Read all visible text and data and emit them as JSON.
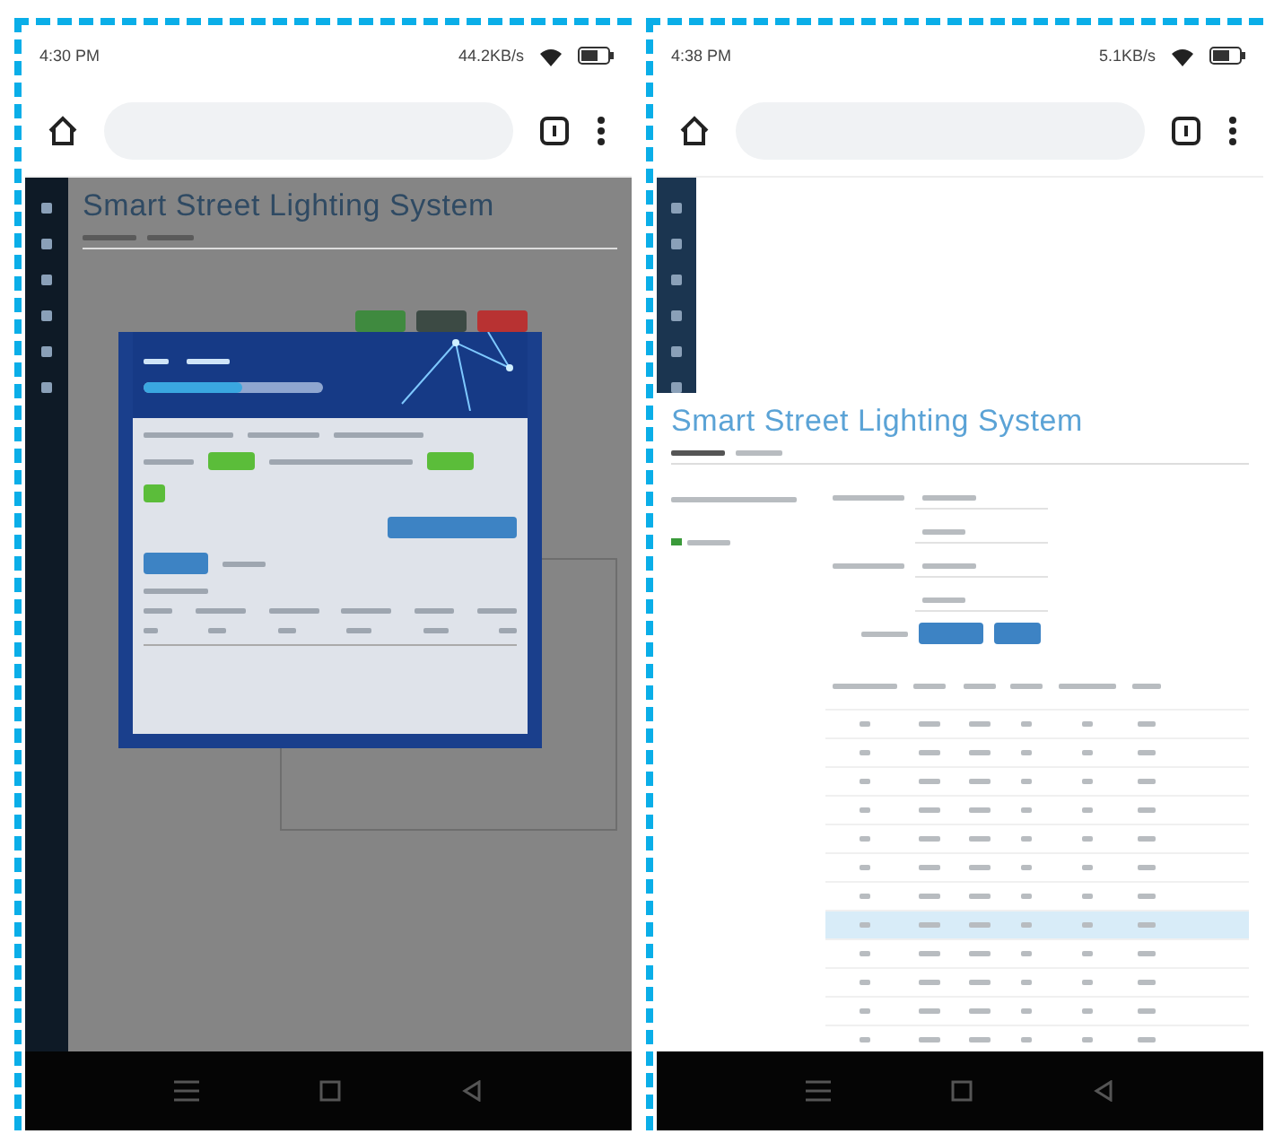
{
  "phones": [
    {
      "kind": "modal",
      "status": {
        "time": "4:30 PM",
        "speed": "44.2KB/s"
      },
      "title": "Smart Street Lighting System",
      "header_progress": {
        "level": 0.55
      },
      "action_buttons": [
        {
          "color": "#3f8a3f"
        },
        {
          "color": "#3c4a44"
        },
        {
          "color": "#b83232"
        }
      ]
    },
    {
      "kind": "table",
      "status": {
        "time": "4:38 PM",
        "speed": "5.1KB/s"
      },
      "title": "Smart Street Lighting System",
      "table": {
        "rows": [
          {
            "selected": false
          },
          {
            "selected": false
          },
          {
            "selected": false
          },
          {
            "selected": false
          },
          {
            "selected": false
          },
          {
            "selected": false
          },
          {
            "selected": false
          },
          {
            "selected": true
          },
          {
            "selected": false
          },
          {
            "selected": false
          },
          {
            "selected": false
          },
          {
            "selected": false
          }
        ]
      }
    }
  ]
}
